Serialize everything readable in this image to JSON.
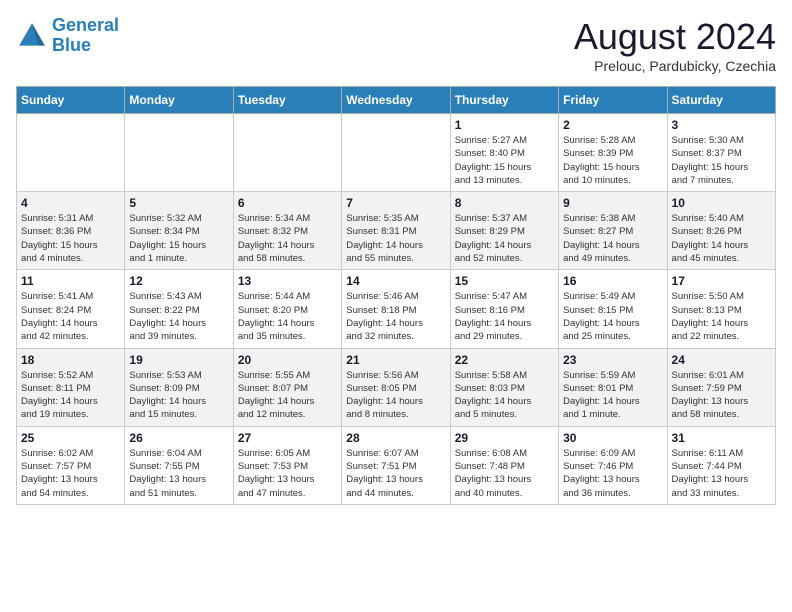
{
  "header": {
    "logo_line1": "General",
    "logo_line2": "Blue",
    "month": "August 2024",
    "location": "Prelouc, Pardubicky, Czechia"
  },
  "days_of_week": [
    "Sunday",
    "Monday",
    "Tuesday",
    "Wednesday",
    "Thursday",
    "Friday",
    "Saturday"
  ],
  "weeks": [
    [
      {
        "day": "",
        "info": ""
      },
      {
        "day": "",
        "info": ""
      },
      {
        "day": "",
        "info": ""
      },
      {
        "day": "",
        "info": ""
      },
      {
        "day": "1",
        "info": "Sunrise: 5:27 AM\nSunset: 8:40 PM\nDaylight: 15 hours\nand 13 minutes."
      },
      {
        "day": "2",
        "info": "Sunrise: 5:28 AM\nSunset: 8:39 PM\nDaylight: 15 hours\nand 10 minutes."
      },
      {
        "day": "3",
        "info": "Sunrise: 5:30 AM\nSunset: 8:37 PM\nDaylight: 15 hours\nand 7 minutes."
      }
    ],
    [
      {
        "day": "4",
        "info": "Sunrise: 5:31 AM\nSunset: 8:36 PM\nDaylight: 15 hours\nand 4 minutes."
      },
      {
        "day": "5",
        "info": "Sunrise: 5:32 AM\nSunset: 8:34 PM\nDaylight: 15 hours\nand 1 minute."
      },
      {
        "day": "6",
        "info": "Sunrise: 5:34 AM\nSunset: 8:32 PM\nDaylight: 14 hours\nand 58 minutes."
      },
      {
        "day": "7",
        "info": "Sunrise: 5:35 AM\nSunset: 8:31 PM\nDaylight: 14 hours\nand 55 minutes."
      },
      {
        "day": "8",
        "info": "Sunrise: 5:37 AM\nSunset: 8:29 PM\nDaylight: 14 hours\nand 52 minutes."
      },
      {
        "day": "9",
        "info": "Sunrise: 5:38 AM\nSunset: 8:27 PM\nDaylight: 14 hours\nand 49 minutes."
      },
      {
        "day": "10",
        "info": "Sunrise: 5:40 AM\nSunset: 8:26 PM\nDaylight: 14 hours\nand 45 minutes."
      }
    ],
    [
      {
        "day": "11",
        "info": "Sunrise: 5:41 AM\nSunset: 8:24 PM\nDaylight: 14 hours\nand 42 minutes."
      },
      {
        "day": "12",
        "info": "Sunrise: 5:43 AM\nSunset: 8:22 PM\nDaylight: 14 hours\nand 39 minutes."
      },
      {
        "day": "13",
        "info": "Sunrise: 5:44 AM\nSunset: 8:20 PM\nDaylight: 14 hours\nand 35 minutes."
      },
      {
        "day": "14",
        "info": "Sunrise: 5:46 AM\nSunset: 8:18 PM\nDaylight: 14 hours\nand 32 minutes."
      },
      {
        "day": "15",
        "info": "Sunrise: 5:47 AM\nSunset: 8:16 PM\nDaylight: 14 hours\nand 29 minutes."
      },
      {
        "day": "16",
        "info": "Sunrise: 5:49 AM\nSunset: 8:15 PM\nDaylight: 14 hours\nand 25 minutes."
      },
      {
        "day": "17",
        "info": "Sunrise: 5:50 AM\nSunset: 8:13 PM\nDaylight: 14 hours\nand 22 minutes."
      }
    ],
    [
      {
        "day": "18",
        "info": "Sunrise: 5:52 AM\nSunset: 8:11 PM\nDaylight: 14 hours\nand 19 minutes."
      },
      {
        "day": "19",
        "info": "Sunrise: 5:53 AM\nSunset: 8:09 PM\nDaylight: 14 hours\nand 15 minutes."
      },
      {
        "day": "20",
        "info": "Sunrise: 5:55 AM\nSunset: 8:07 PM\nDaylight: 14 hours\nand 12 minutes."
      },
      {
        "day": "21",
        "info": "Sunrise: 5:56 AM\nSunset: 8:05 PM\nDaylight: 14 hours\nand 8 minutes."
      },
      {
        "day": "22",
        "info": "Sunrise: 5:58 AM\nSunset: 8:03 PM\nDaylight: 14 hours\nand 5 minutes."
      },
      {
        "day": "23",
        "info": "Sunrise: 5:59 AM\nSunset: 8:01 PM\nDaylight: 14 hours\nand 1 minute."
      },
      {
        "day": "24",
        "info": "Sunrise: 6:01 AM\nSunset: 7:59 PM\nDaylight: 13 hours\nand 58 minutes."
      }
    ],
    [
      {
        "day": "25",
        "info": "Sunrise: 6:02 AM\nSunset: 7:57 PM\nDaylight: 13 hours\nand 54 minutes."
      },
      {
        "day": "26",
        "info": "Sunrise: 6:04 AM\nSunset: 7:55 PM\nDaylight: 13 hours\nand 51 minutes."
      },
      {
        "day": "27",
        "info": "Sunrise: 6:05 AM\nSunset: 7:53 PM\nDaylight: 13 hours\nand 47 minutes."
      },
      {
        "day": "28",
        "info": "Sunrise: 6:07 AM\nSunset: 7:51 PM\nDaylight: 13 hours\nand 44 minutes."
      },
      {
        "day": "29",
        "info": "Sunrise: 6:08 AM\nSunset: 7:48 PM\nDaylight: 13 hours\nand 40 minutes."
      },
      {
        "day": "30",
        "info": "Sunrise: 6:09 AM\nSunset: 7:46 PM\nDaylight: 13 hours\nand 36 minutes."
      },
      {
        "day": "31",
        "info": "Sunrise: 6:11 AM\nSunset: 7:44 PM\nDaylight: 13 hours\nand 33 minutes."
      }
    ]
  ]
}
